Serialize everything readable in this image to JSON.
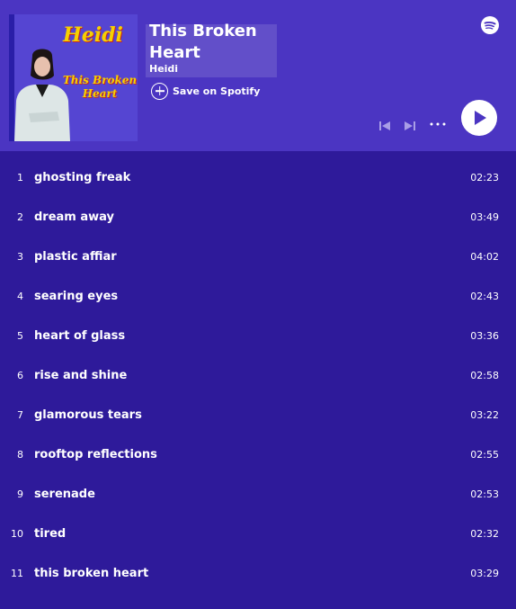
{
  "album": {
    "cover_artist_text": "Heidi",
    "cover_title_text": "This Broken Heart",
    "title": "This Broken Heart",
    "artist": "Heidi",
    "save_label": "Save on Spotify"
  },
  "icons": {
    "logo": "spotify-logo-icon",
    "save": "plus-circle-icon",
    "prev": "skip-back-icon",
    "next": "skip-forward-icon",
    "more": "more-dots-icon",
    "play": "play-icon"
  },
  "colors": {
    "header_bg": "#4b35c2",
    "list_bg": "#2e1a9a",
    "text": "#ffffff",
    "cover_text": "#f6d000"
  },
  "tracks": [
    {
      "num": "1",
      "name": "ghosting freak",
      "duration": "02:23"
    },
    {
      "num": "2",
      "name": "dream away",
      "duration": "03:49"
    },
    {
      "num": "3",
      "name": "plastic affiar",
      "duration": "04:02"
    },
    {
      "num": "4",
      "name": "searing eyes",
      "duration": "02:43"
    },
    {
      "num": "5",
      "name": "heart of glass",
      "duration": "03:36"
    },
    {
      "num": "6",
      "name": "rise and shine",
      "duration": "02:58"
    },
    {
      "num": "7",
      "name": "glamorous tears",
      "duration": "03:22"
    },
    {
      "num": "8",
      "name": "rooftop reflections",
      "duration": "02:55"
    },
    {
      "num": "9",
      "name": "serenade",
      "duration": "02:53"
    },
    {
      "num": "10",
      "name": "tired",
      "duration": "02:32"
    },
    {
      "num": "11",
      "name": "this broken heart",
      "duration": "03:29"
    }
  ]
}
